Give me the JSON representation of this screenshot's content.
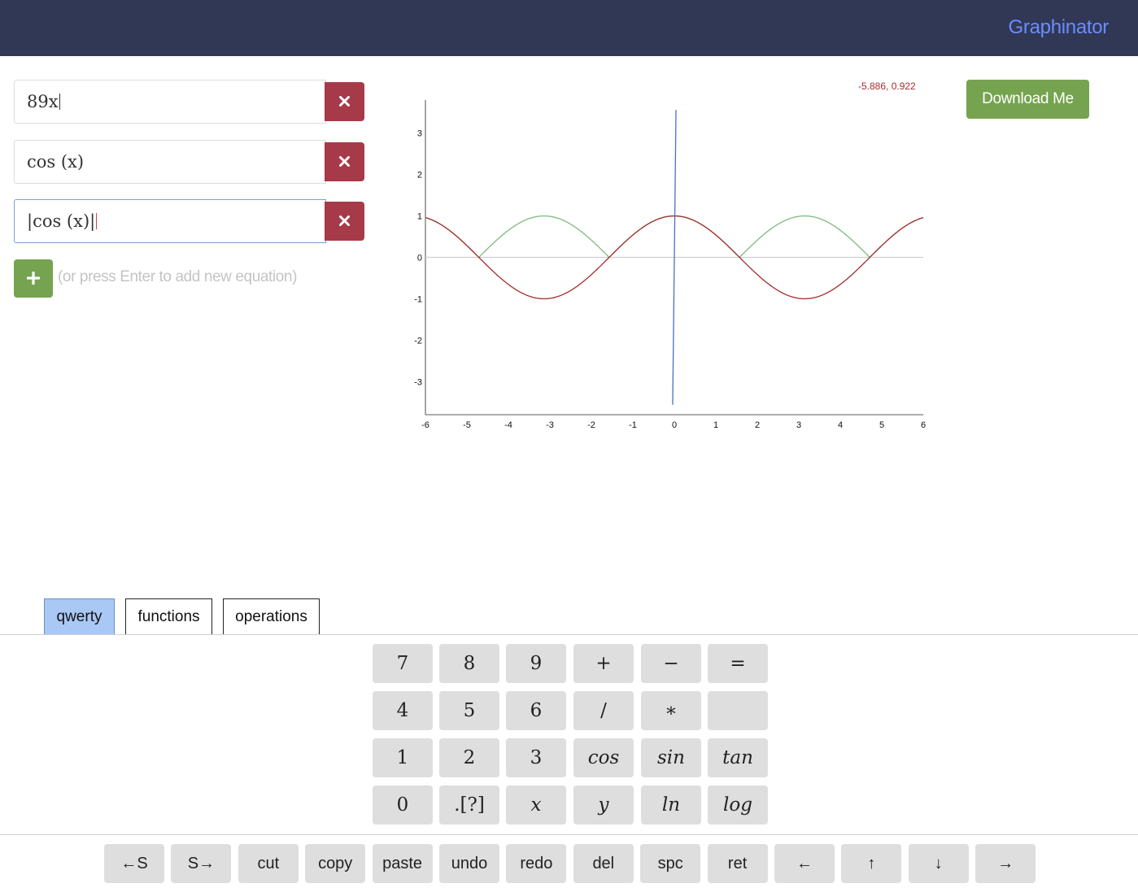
{
  "app": {
    "brand": "Graphinator",
    "download_label": "Download Me",
    "add_hint": "(or press Enter to add new equation)",
    "coord_readout": "-5.886, 0.922"
  },
  "equations": [
    {
      "expr": "89x",
      "color": "#4a6fc9",
      "focused": false
    },
    {
      "expr": "cos (x)",
      "color": "#a32d2d",
      "focused": false
    },
    {
      "expr": "|cos (x)|",
      "color": "#7fba7f",
      "focused": true
    }
  ],
  "keyboard": {
    "tabs": [
      "qwerty",
      "functions",
      "operations"
    ],
    "active_tab": "qwerty",
    "rows": [
      [
        "7",
        "8",
        "9",
        "+",
        "−",
        "="
      ],
      [
        "4",
        "5",
        "6",
        "/",
        "∗",
        ""
      ],
      [
        "1",
        "2",
        "3",
        "cos",
        "sin",
        "tan"
      ],
      [
        "0",
        ".[?]",
        "x",
        "y",
        "ln",
        "log"
      ]
    ],
    "actions": [
      "←S",
      "S→",
      "cut",
      "copy",
      "paste",
      "undo",
      "redo",
      "del",
      "spc",
      "ret",
      "←",
      "↑",
      "↓",
      "→"
    ]
  },
  "chart_data": {
    "type": "line",
    "xlim": [
      -6,
      6
    ],
    "ylim": [
      -3.8,
      3.8
    ],
    "x_ticks": [
      "-6",
      "-5",
      "-4",
      "-3",
      "-2",
      "-1",
      "0",
      "1",
      "2",
      "3",
      "4",
      "5",
      "6"
    ],
    "y_ticks": [
      "3",
      "2",
      "1",
      "0",
      "-1",
      "-2",
      "-3"
    ],
    "series": [
      {
        "expr": "89x",
        "color": "#4a6fc9"
      },
      {
        "expr": "cos(x)",
        "color": "#a32d2d"
      },
      {
        "expr": "|cos(x)|",
        "color": "#7fba7f"
      }
    ],
    "grid": false
  }
}
